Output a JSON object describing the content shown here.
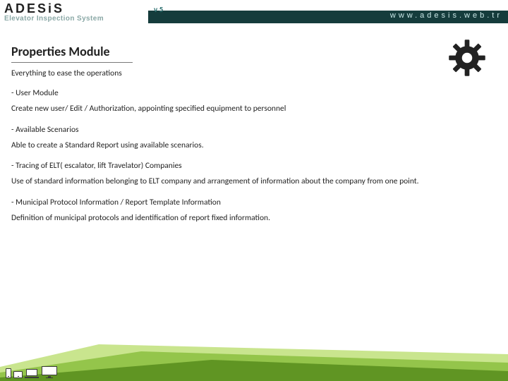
{
  "header": {
    "logo_main": "ADESiS",
    "logo_sub": "Elevator Inspection System",
    "version": "v 5",
    "url": "www.adesis.web.tr"
  },
  "page": {
    "title": "Properties Module",
    "subtitle": "Everything to ease the operations"
  },
  "sections": [
    {
      "head": " - User Module",
      "body": "Create new user/ Edit  / Authorization, appointing specified equipment to personnel"
    },
    {
      "head": " - Available Scenarios",
      "body": "Able to create a Standard Report using available scenarios."
    },
    {
      "head": " - Tracing of ELT( escalator, lift Travelator) Companies",
      "body": "Use of standard information belonging to ELT company and arrangement of information about the company from one point."
    },
    {
      "head": " - Municipal Protocol Information / Report Template Information",
      "body": "Definition of municipal protocols and identification of report fixed information."
    }
  ]
}
